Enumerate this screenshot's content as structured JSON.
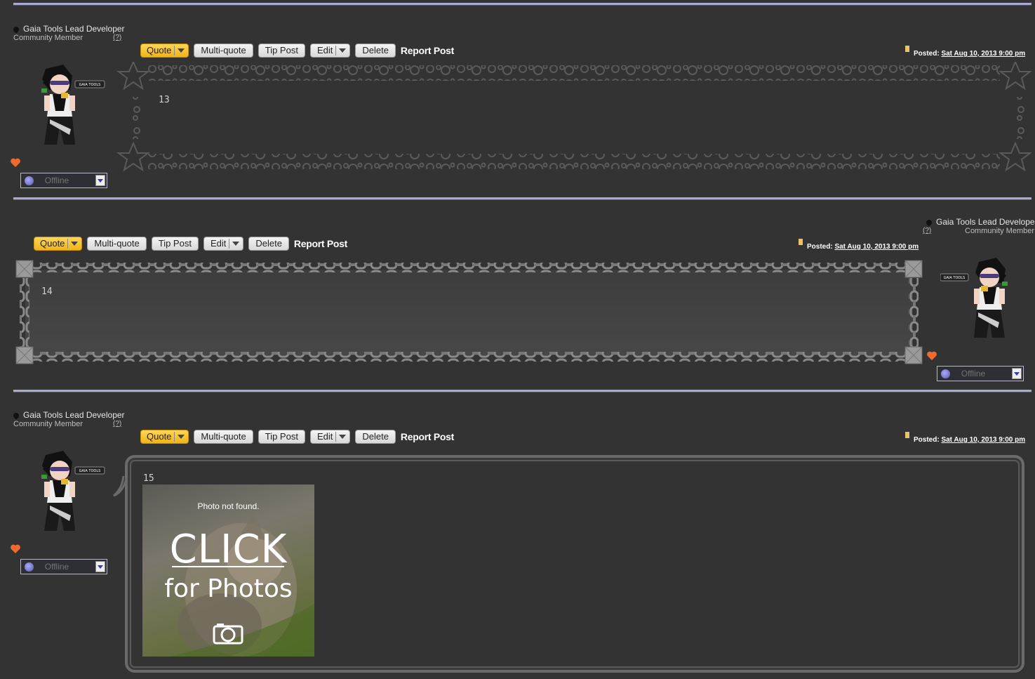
{
  "user": {
    "title": "Gaia Tools Lead Developer",
    "rank": "Community Member",
    "help": "(?)",
    "status": "Offline",
    "avatar_badge": "GAIA TOOLS"
  },
  "toolbar": {
    "quote": "Quote",
    "multiquote": "Multi-quote",
    "tip": "Tip Post",
    "edit": "Edit",
    "delete": "Delete",
    "report": "Report Post"
  },
  "posts": [
    {
      "number": "13",
      "posted_label": "Posted:",
      "date": "Sat Aug 10, 2013 9:00 pm"
    },
    {
      "number": "14",
      "posted_label": "Posted:",
      "date": "Sat Aug 10, 2013 9:00 pm"
    },
    {
      "number": "15",
      "posted_label": "Posted:",
      "date": "Sat Aug 10, 2013 9:00 pm"
    }
  ],
  "photo": {
    "not_found": "Photo not found.",
    "click": "CLICK",
    "for_photos": "for Photos"
  },
  "icons": [
    "pin-icon",
    "heart-icon",
    "status-orb-icon",
    "dropdown-arrow-icon",
    "posted-icon",
    "camera-icon"
  ],
  "colors": {
    "background": "#333334",
    "divider": "#a9a9d6",
    "quote_button": "#f5c234"
  }
}
